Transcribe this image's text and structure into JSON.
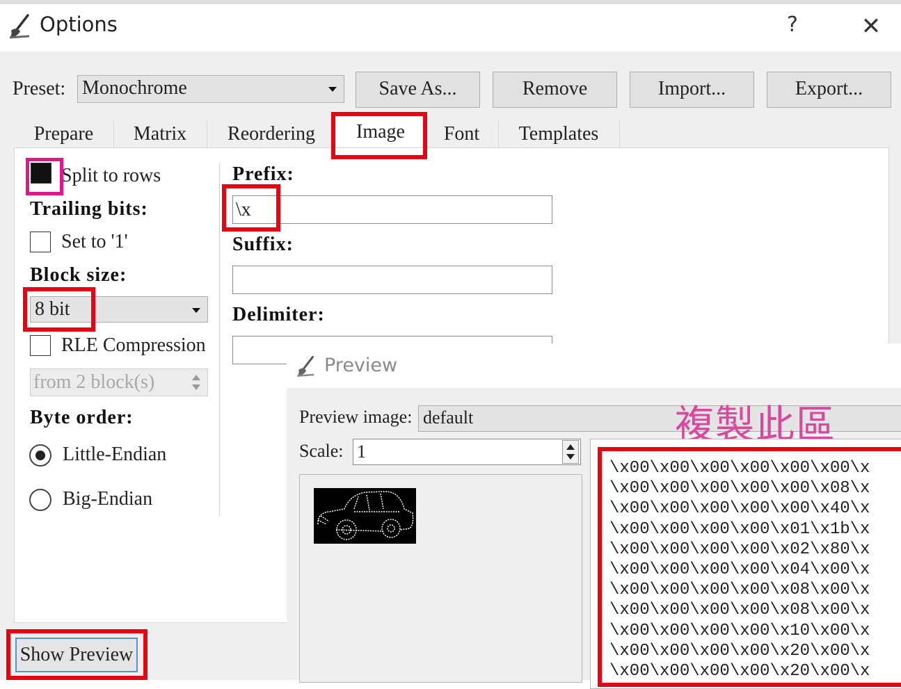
{
  "window": {
    "title": "Options",
    "help_label": "?",
    "close_label": "✕"
  },
  "preset": {
    "label": "Preset:",
    "value": "Monochrome",
    "buttons": [
      "Save As...",
      "Remove",
      "Import...",
      "Export..."
    ]
  },
  "tabs": [
    "Prepare",
    "Matrix",
    "Reordering",
    "Image",
    "Font",
    "Templates"
  ],
  "active_tab": "Image",
  "left_options": {
    "split_to_rows": {
      "label": "Split to rows",
      "checked": true
    },
    "trailing_bits_heading": "Trailing bits:",
    "set_to_one": {
      "label": "Set to '1'",
      "checked": false
    },
    "block_size_heading": "Block size:",
    "block_size_value": "8 bit",
    "rle": {
      "label": "RLE Compression",
      "checked": false
    },
    "rle_spin_value": "from 2 block(s)",
    "byte_order_heading": "Byte order:",
    "little_endian": {
      "label": "Little-Endian",
      "selected": true
    },
    "big_endian": {
      "label": "Big-Endian",
      "selected": false
    }
  },
  "right_options": {
    "prefix_heading": "Prefix:",
    "prefix_value": "\\x",
    "suffix_heading": "Suffix:",
    "suffix_value": "",
    "delimiter_heading": "Delimiter:",
    "delimiter_value": ""
  },
  "show_preview_button": "Show Preview",
  "preview": {
    "title": "Preview",
    "image_label": "Preview image:",
    "image_value": "default",
    "scale_label": "Scale:",
    "scale_value": "1",
    "annotation": "複製此區",
    "output_lines": [
      "\\x00\\x00\\x00\\x00\\x00\\x00\\x",
      "\\x00\\x00\\x00\\x00\\x00\\x08\\x",
      "\\x00\\x00\\x00\\x00\\x00\\x40\\x",
      "\\x00\\x00\\x00\\x00\\x01\\x1b\\x",
      "\\x00\\x00\\x00\\x00\\x02\\x80\\x",
      "\\x00\\x00\\x00\\x00\\x04\\x00\\x",
      "\\x00\\x00\\x00\\x00\\x08\\x00\\x",
      "\\x00\\x00\\x00\\x00\\x08\\x00\\x",
      "\\x00\\x00\\x00\\x00\\x10\\x00\\x",
      "\\x00\\x00\\x00\\x00\\x20\\x00\\x",
      "\\x00\\x00\\x00\\x00\\x20\\x00\\x"
    ]
  },
  "colors": {
    "highlight_red": "#e30613",
    "highlight_pink": "#e0168a",
    "annotation_text": "#d9489c"
  }
}
